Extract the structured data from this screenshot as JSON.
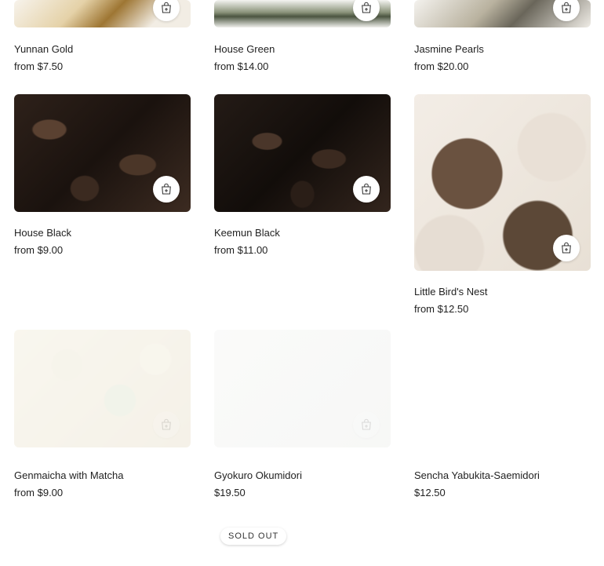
{
  "products": [
    {
      "name": "Yunnan Gold",
      "price": "from $7.50",
      "palette": [
        "#f5f1ea",
        "#c9a45a",
        "#8f6a2c"
      ],
      "icon": "add-to-cart-icon"
    },
    {
      "name": "House Green",
      "price": "from $14.00",
      "palette": [
        "#f4f4f1",
        "#6e7a59",
        "#3f4a33"
      ],
      "icon": "add-to-cart-icon"
    },
    {
      "name": "Jasmine Pearls",
      "price": "from $20.00",
      "palette": [
        "#f4f2ee",
        "#9c9582",
        "#5d5a4e"
      ],
      "icon": "add-to-cart-icon"
    },
    {
      "name": "House Black",
      "price": "from $9.00",
      "palette": [
        "#3a2b22",
        "#1f1612",
        "#5a4131"
      ],
      "icon": "add-to-cart-icon"
    },
    {
      "name": "Keemun Black",
      "price": "from $11.00",
      "palette": [
        "#2b211c",
        "#15100d",
        "#4a362a"
      ],
      "icon": "add-to-cart-icon"
    },
    {
      "name": "Little Bird's Nest",
      "price": "from $12.50",
      "palette": [
        "#efe8df",
        "#5a4636",
        "#c85a4f"
      ],
      "icon": "add-to-cart-icon"
    },
    {
      "name": "Genmaicha with Matcha",
      "price": "from $9.00",
      "palette": [
        "#e9dfb7",
        "#c8b77e",
        "#a7b27a"
      ],
      "icon": "add-to-cart-icon"
    },
    {
      "name": "Gyokuro Okumidori",
      "price": "$19.50",
      "palette": [
        "#f1f2ee",
        "#dadcd5",
        "#c6c9bf"
      ],
      "icon": "add-to-cart-icon"
    },
    {
      "name": "Sencha Yabukita-Saemidori",
      "price": "$12.50",
      "palette": [
        "#ffffff",
        "#ffffff",
        "#ffffff"
      ],
      "icon": "add-to-cart-icon"
    }
  ],
  "badge": {
    "label": "SOLD OUT"
  }
}
